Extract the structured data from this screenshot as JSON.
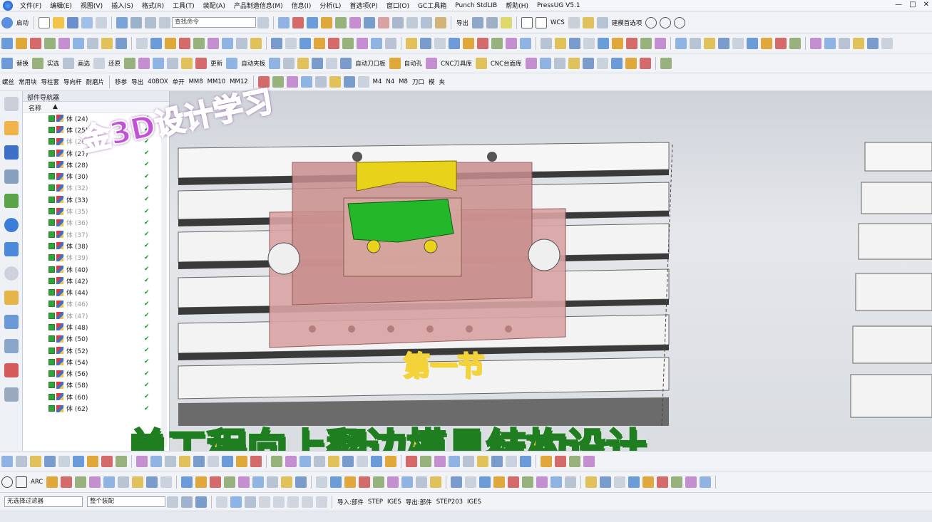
{
  "menu": {
    "items": [
      "文件(F)",
      "编辑(E)",
      "视图(V)",
      "插入(S)",
      "格式(R)",
      "工具(T)",
      "装配(A)",
      "产品制造信息(M)",
      "信息(I)",
      "分析(L)",
      "首选项(P)",
      "窗口(O)",
      "GC工具箱",
      "Punch StdLIB",
      "帮助(H)",
      "PressUG V5.1"
    ]
  },
  "toolbar1": {
    "start": "启动",
    "search_placeholder": "查找命令",
    "export": "导出",
    "wcs": "WCS",
    "pref": "建模首选项"
  },
  "toolbar3": {
    "labels": [
      "替换",
      "实选",
      "画选",
      "还原",
      "更新",
      "自动夹板",
      "自动刀口板",
      "自动孔",
      "CNC刀具库",
      "CNC台面库"
    ]
  },
  "toolbar4": {
    "labels": [
      "螺丝",
      "常用块",
      "导柱套",
      "导向杆",
      "耐磨片",
      "移参",
      "导出",
      "40BOX",
      "单开",
      "MM8",
      "MM10",
      "MM12",
      "M4",
      "N4",
      "M8",
      "刀口",
      "模",
      "夹"
    ]
  },
  "navigator": {
    "title": "部件导航器",
    "col_name": "名称",
    "rows": [
      {
        "label": "体 (24)",
        "dim": false
      },
      {
        "label": "体 (25)",
        "dim": false
      },
      {
        "label": "体 (26)",
        "dim": true
      },
      {
        "label": "体 (27)",
        "dim": false
      },
      {
        "label": "体 (28)",
        "dim": false
      },
      {
        "label": "体 (30)",
        "dim": false
      },
      {
        "label": "体 (32)",
        "dim": true
      },
      {
        "label": "体 (33)",
        "dim": false
      },
      {
        "label": "体 (35)",
        "dim": true
      },
      {
        "label": "体 (36)",
        "dim": true
      },
      {
        "label": "体 (37)",
        "dim": true
      },
      {
        "label": "体 (38)",
        "dim": false
      },
      {
        "label": "体 (39)",
        "dim": true
      },
      {
        "label": "体 (40)",
        "dim": false
      },
      {
        "label": "体 (42)",
        "dim": false
      },
      {
        "label": "体 (44)",
        "dim": false
      },
      {
        "label": "体 (46)",
        "dim": true
      },
      {
        "label": "体 (47)",
        "dim": true
      },
      {
        "label": "体 (48)",
        "dim": false
      },
      {
        "label": "体 (50)",
        "dim": false
      },
      {
        "label": "体 (52)",
        "dim": false
      },
      {
        "label": "体 (54)",
        "dim": false
      },
      {
        "label": "体 (56)",
        "dim": false
      },
      {
        "label": "体 (58)",
        "dim": false
      },
      {
        "label": "体 (60)",
        "dim": false
      },
      {
        "label": "体 (62)",
        "dim": false
      }
    ]
  },
  "overlay": {
    "brand": "金3D设计学习",
    "section": "第一节",
    "title": "单工程向上翻边模具结构设计"
  },
  "bottom": {
    "filter": "无选择过滤器",
    "assembly": "整个装配",
    "import_part": "导入:部件",
    "step": "STEP",
    "iges": "IGES",
    "export_part": "导出:部件",
    "step203": "STEP203",
    "iges2": "IGES",
    "arc": "ARC"
  },
  "colors": {
    "accent": "#1b4fb0",
    "pink_plate": "#d9a3a3",
    "yellow_part": "#e8d31a",
    "green_part": "#22b82a"
  }
}
